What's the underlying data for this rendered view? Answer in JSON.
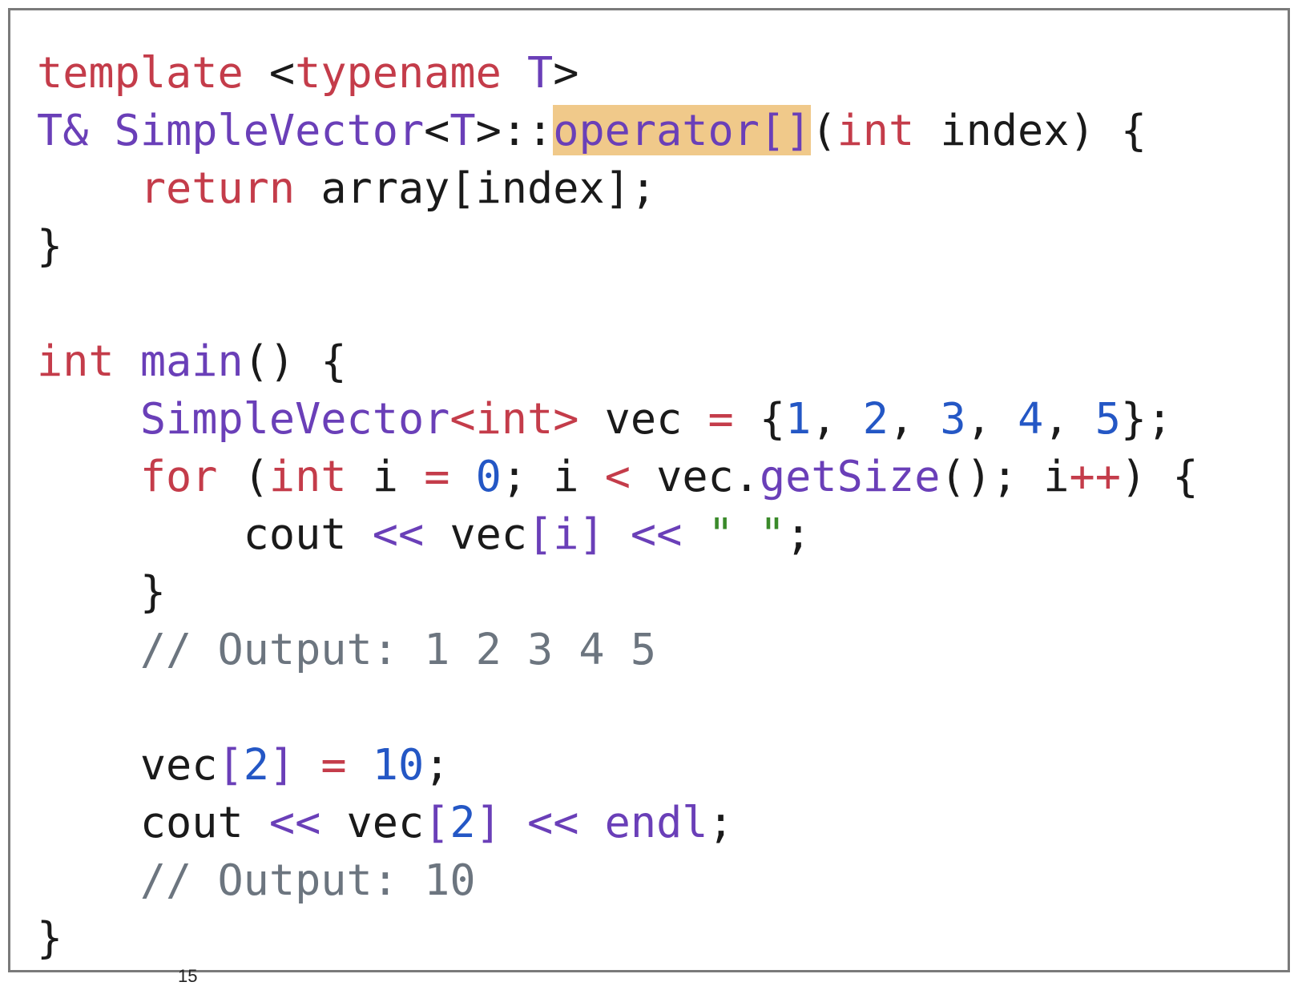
{
  "code": {
    "lines": [
      [
        {
          "t": "template",
          "k": "kw"
        },
        {
          "t": " <",
          "k": "pl"
        },
        {
          "t": "typename",
          "k": "kw"
        },
        {
          "t": " ",
          "k": "pl"
        },
        {
          "t": "T",
          "k": "ty"
        },
        {
          "t": ">",
          "k": "pl"
        }
      ],
      [
        {
          "t": "T&",
          "k": "ty"
        },
        {
          "t": " ",
          "k": "pl"
        },
        {
          "t": "SimpleVector",
          "k": "ty"
        },
        {
          "t": "<",
          "k": "pl"
        },
        {
          "t": "T",
          "k": "ty"
        },
        {
          "t": ">::",
          "k": "pl"
        },
        {
          "t": "operator[]",
          "k": "fn",
          "highlight": true
        },
        {
          "t": "(",
          "k": "pl"
        },
        {
          "t": "int",
          "k": "kw"
        },
        {
          "t": " index) {",
          "k": "pl"
        }
      ],
      [
        {
          "t": "    ",
          "k": "pl"
        },
        {
          "t": "return",
          "k": "kw"
        },
        {
          "t": " array[index];",
          "k": "pl"
        }
      ],
      [
        {
          "t": "}",
          "k": "pl"
        }
      ],
      [],
      [
        {
          "t": "int",
          "k": "kw"
        },
        {
          "t": " ",
          "k": "pl"
        },
        {
          "t": "main",
          "k": "fn"
        },
        {
          "t": "() {",
          "k": "pl"
        }
      ],
      [
        {
          "t": "    ",
          "k": "pl"
        },
        {
          "t": "SimpleVector",
          "k": "ty"
        },
        {
          "t": "<int>",
          "k": "kw"
        },
        {
          "t": " vec ",
          "k": "pl"
        },
        {
          "t": "=",
          "k": "kw"
        },
        {
          "t": " {",
          "k": "pl"
        },
        {
          "t": "1",
          "k": "num"
        },
        {
          "t": ", ",
          "k": "pl"
        },
        {
          "t": "2",
          "k": "num"
        },
        {
          "t": ", ",
          "k": "pl"
        },
        {
          "t": "3",
          "k": "num"
        },
        {
          "t": ", ",
          "k": "pl"
        },
        {
          "t": "4",
          "k": "num"
        },
        {
          "t": ", ",
          "k": "pl"
        },
        {
          "t": "5",
          "k": "num"
        },
        {
          "t": "};",
          "k": "pl"
        }
      ],
      [
        {
          "t": "    ",
          "k": "pl"
        },
        {
          "t": "for",
          "k": "kw"
        },
        {
          "t": " (",
          "k": "pl"
        },
        {
          "t": "int",
          "k": "kw"
        },
        {
          "t": " i ",
          "k": "pl"
        },
        {
          "t": "=",
          "k": "kw"
        },
        {
          "t": " ",
          "k": "pl"
        },
        {
          "t": "0",
          "k": "num"
        },
        {
          "t": "; i ",
          "k": "pl"
        },
        {
          "t": "<",
          "k": "kw"
        },
        {
          "t": " vec.",
          "k": "pl"
        },
        {
          "t": "getSize",
          "k": "fn"
        },
        {
          "t": "(); i",
          "k": "pl"
        },
        {
          "t": "++",
          "k": "kw"
        },
        {
          "t": ") {",
          "k": "pl"
        }
      ],
      [
        {
          "t": "        cout ",
          "k": "pl"
        },
        {
          "t": "<<",
          "k": "op"
        },
        {
          "t": " vec",
          "k": "pl"
        },
        {
          "t": "[i]",
          "k": "op"
        },
        {
          "t": " ",
          "k": "pl"
        },
        {
          "t": "<<",
          "k": "op"
        },
        {
          "t": " ",
          "k": "pl"
        },
        {
          "t": "\" \"",
          "k": "str"
        },
        {
          "t": ";",
          "k": "pl"
        }
      ],
      [
        {
          "t": "    }",
          "k": "pl"
        }
      ],
      [
        {
          "t": "    ",
          "k": "pl"
        },
        {
          "t": "// Output: 1 2 3 4 5",
          "k": "cm"
        }
      ],
      [],
      [
        {
          "t": "    vec",
          "k": "pl"
        },
        {
          "t": "[",
          "k": "op"
        },
        {
          "t": "2",
          "k": "num"
        },
        {
          "t": "]",
          "k": "op"
        },
        {
          "t": " ",
          "k": "pl"
        },
        {
          "t": "=",
          "k": "kw"
        },
        {
          "t": " ",
          "k": "pl"
        },
        {
          "t": "10",
          "k": "num"
        },
        {
          "t": ";",
          "k": "pl"
        }
      ],
      [
        {
          "t": "    cout ",
          "k": "pl"
        },
        {
          "t": "<<",
          "k": "op"
        },
        {
          "t": " vec",
          "k": "pl"
        },
        {
          "t": "[",
          "k": "op"
        },
        {
          "t": "2",
          "k": "num"
        },
        {
          "t": "]",
          "k": "op"
        },
        {
          "t": " ",
          "k": "pl"
        },
        {
          "t": "<<",
          "k": "op"
        },
        {
          "t": " ",
          "k": "pl"
        },
        {
          "t": "endl",
          "k": "fn"
        },
        {
          "t": ";",
          "k": "pl"
        }
      ],
      [
        {
          "t": "    ",
          "k": "pl"
        },
        {
          "t": "// Output: 10",
          "k": "cm"
        }
      ],
      [
        {
          "t": "}",
          "k": "pl"
        }
      ]
    ]
  },
  "page_number": "15",
  "colors": {
    "keyword": "#c43c4a",
    "type": "#6a3fb8",
    "number": "#2457c5",
    "string": "#3a8a2a",
    "comment": "#6c757f",
    "highlight": "#f0c98a",
    "border": "#7a7a7a"
  }
}
